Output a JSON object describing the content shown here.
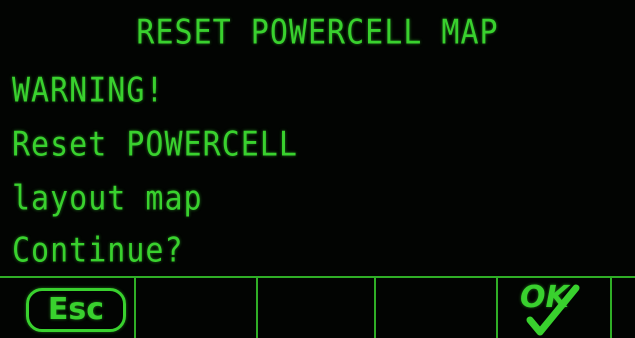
{
  "display": {
    "title": "RESET POWERCELL MAP",
    "lines": [
      "WARNING!",
      "Reset POWERCELL",
      "layout map",
      "Continue?"
    ]
  },
  "softkeys": {
    "esc_label": "Esc",
    "ok_label": "OK"
  },
  "colors": {
    "lcd_background": "#020402",
    "lcd_text": "#39d12e",
    "divider": "#2fae26"
  },
  "icons": {
    "esc": "esc-softkey-icon",
    "ok": "ok-checkmark-icon"
  }
}
